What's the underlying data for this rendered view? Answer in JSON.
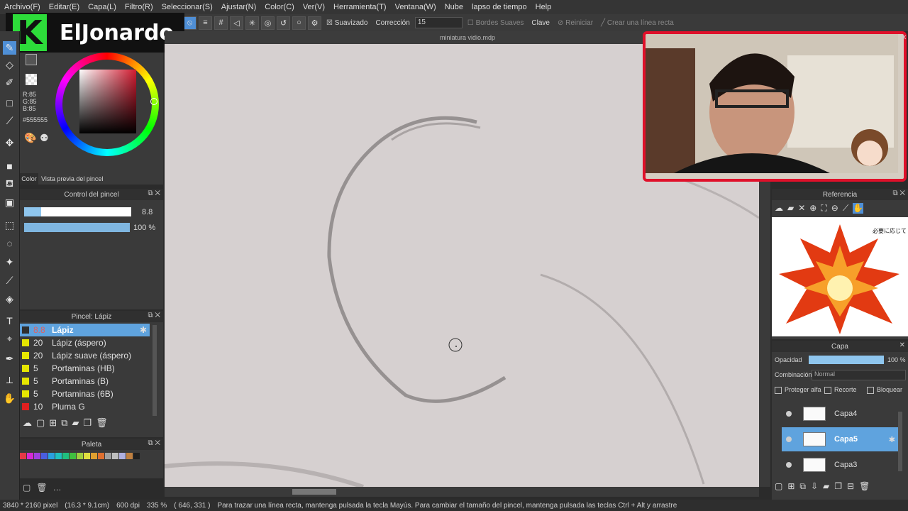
{
  "menu": [
    "Archivo(F)",
    "Editar(E)",
    "Capa(L)",
    "Filtro(R)",
    "Seleccionar(S)",
    "Ajustar(N)",
    "Color(C)",
    "Ver(V)",
    "Herramienta(T)",
    "Ventana(W)",
    "Nube",
    "lapso de tiempo",
    "Help"
  ],
  "toolbar": {
    "smoothing_label": "Suavizado",
    "correction_label": "Corrección",
    "correction_value": "15",
    "soft_edges_label": "Bordes Suaves",
    "key_label": "Clave",
    "reset_label": "Reiniciar",
    "line_label": "Crear una línea recta"
  },
  "doc_title": "miniatura vidio.mdp",
  "streamer": {
    "name": "ElJonardo",
    "logo_letter": "K"
  },
  "color_panel": {
    "r": "R:85",
    "g": "G:85",
    "b": "B:85",
    "hex": "#555555",
    "tab_color": "Color",
    "tab_preview": "Vista previa del pincel"
  },
  "brush_control": {
    "title": "Control del pincel",
    "size_value": "8.8",
    "size_fraction": 0.16,
    "opacity_value": "100 %",
    "opacity_fraction": 1.0
  },
  "brush_panel": {
    "title": "Pincel: Lápiz",
    "items": [
      {
        "size": "8.8",
        "name": "Lápiz",
        "color": "#2f2f2f"
      },
      {
        "size": "20",
        "name": "Lápiz (áspero)",
        "color": "#e6e600"
      },
      {
        "size": "20",
        "name": "Lápiz suave (áspero)",
        "color": "#e6e600"
      },
      {
        "size": "5",
        "name": "Portaminas (HB)",
        "color": "#e6e600"
      },
      {
        "size": "5",
        "name": "Portaminas (B)",
        "color": "#e6e600"
      },
      {
        "size": "5",
        "name": "Portaminas (6B)",
        "color": "#e6e600"
      },
      {
        "size": "10",
        "name": "Pluma G",
        "color": "#e02020"
      }
    ]
  },
  "palette": {
    "title": "Paleta",
    "colors": [
      "#e63946",
      "#d62ad6",
      "#a040e0",
      "#4a5ee0",
      "#2aa0e0",
      "#20c0c0",
      "#20c080",
      "#40c040",
      "#a0d040",
      "#e0e040",
      "#e0a030",
      "#e07030",
      "#a0a0a0",
      "#c0c0c0",
      "#b0b0e0",
      "#c08040",
      "#202020"
    ]
  },
  "reference": {
    "title": "Referencia",
    "caption": "必要に応じて"
  },
  "layers": {
    "title": "Capa",
    "opacity_label": "Opacidad",
    "opacity_value": "100 %",
    "blend_label": "Combinación",
    "blend_value": "Normal",
    "protect_alpha": "Proteger alfa",
    "clip": "Recorte",
    "lock": "Bloquear",
    "items": [
      {
        "name": "Capa4",
        "selected": false
      },
      {
        "name": "Capa5",
        "selected": true
      },
      {
        "name": "Capa3",
        "selected": false
      }
    ]
  },
  "status": {
    "size": "3840 * 2160 pixel",
    "physical": "(16.3 * 9.1cm)",
    "dpi": "600 dpi",
    "zoom": "335 %",
    "cursor": "( 646, 331 )",
    "hint": "Para trazar una línea recta, mantenga pulsada la tecla Mayús. Para cambiar el tamaño del pincel, mantenga pulsada las teclas Ctrl + Alt y arrastre"
  },
  "colors": {
    "accent": "#4f8fd6",
    "frame_red": "#e0102a",
    "canvas": "#d6d0d0"
  }
}
